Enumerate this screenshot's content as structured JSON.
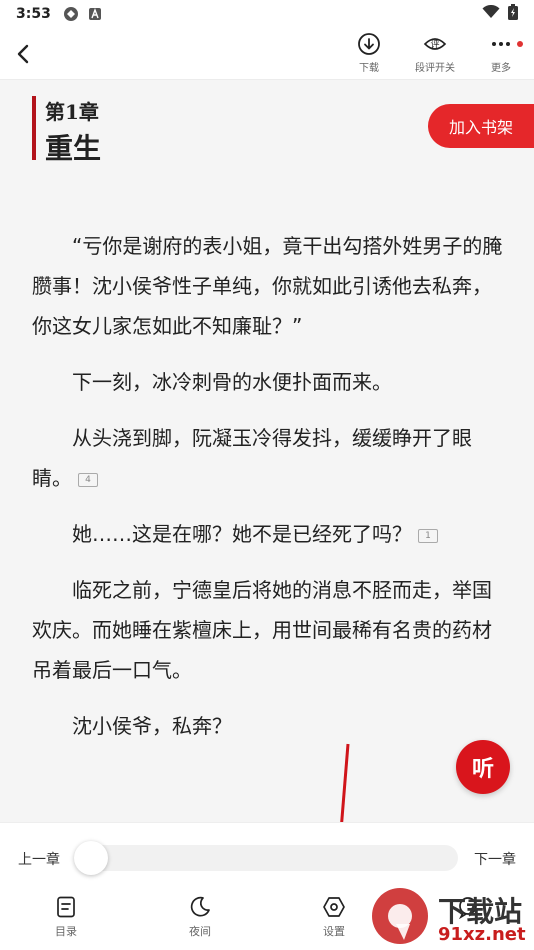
{
  "statusbar": {
    "time": "3:53"
  },
  "toolbar": {
    "download_label": "下载",
    "comment_label": "段评开关",
    "comment_icon_text": "评",
    "more_label": "更多"
  },
  "chapter": {
    "number": "第1章",
    "title": "重生",
    "add_shelf_label": "加入书架",
    "paragraphs": [
      "“亏你是谢府的表小姐，竟干出勾搭外姓男子的腌臜事！沈小侯爷性子单纯，你就如此引诱他去私奔，你这女儿家怎如此不知廉耻？”",
      "下一刻，冰冷刺骨的水便扑面而来。",
      "从头浇到脚，阮凝玉冷得发抖，缓缓睁开了眼睛。",
      "她……这是在哪？她不是已经死了吗？",
      "临死之前，宁德皇后将她的消息不胫而走，举国欢庆。而她睡在紫檀床上，用世间最稀有名贵的药材吊着最后一口气。",
      "沈小侯爷，私奔？"
    ],
    "comment_counts": {
      "p3": "4",
      "p4": "1"
    },
    "listen_label": "听"
  },
  "bottom": {
    "prev_chapter": "上一章",
    "next_chapter": "下一章",
    "progress": 0.0,
    "nav": {
      "catalog": "目录",
      "night": "夜间",
      "settings": "设置"
    }
  },
  "watermark": {
    "name": "下载站",
    "url": "91xz.net"
  },
  "colors": {
    "accent": "#e5272a",
    "chapter_bar": "#b3141b",
    "arrow": "#d0141a"
  }
}
